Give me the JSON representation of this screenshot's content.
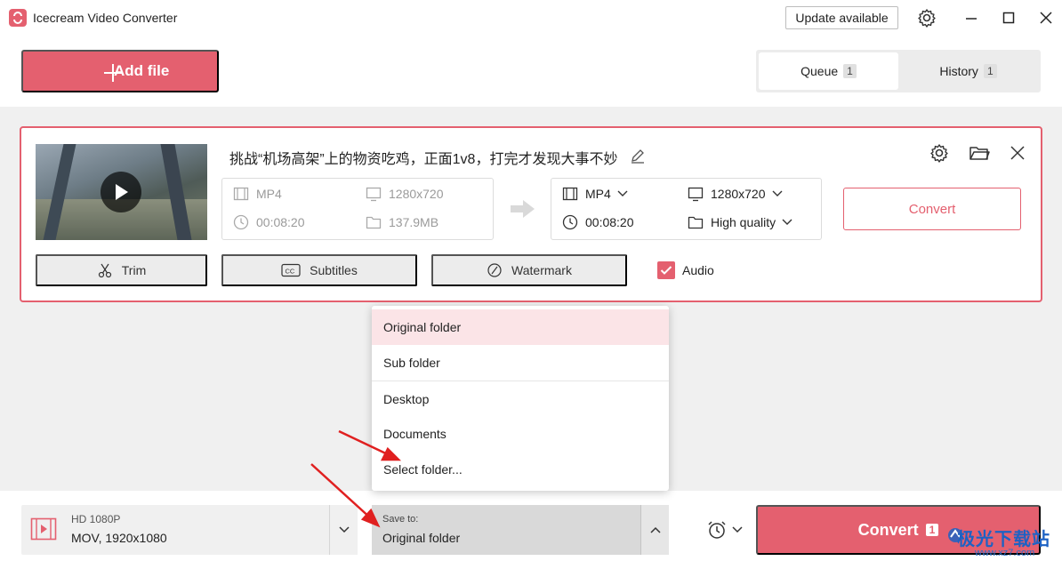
{
  "window": {
    "title": "Icecream Video Converter",
    "update_label": "Update available"
  },
  "toolbar": {
    "add_file_label": "Add file"
  },
  "tabs": [
    {
      "label": "Queue",
      "count": "1",
      "active": true
    },
    {
      "label": "History",
      "count": "1",
      "active": false
    }
  ],
  "file": {
    "title": "挑战“机场高架”上的物资吃鸡，正面1v8，打完才发现大事不妙",
    "source": {
      "format": "MP4",
      "resolution": "1280x720",
      "duration": "00:08:20",
      "size": "137.9MB"
    },
    "target": {
      "format": "MP4",
      "resolution": "1280x720",
      "duration": "00:08:20",
      "quality": "High quality"
    },
    "convert_label": "Convert",
    "tools": {
      "trim": "Trim",
      "subtitles": "Subtitles",
      "watermark": "Watermark",
      "audio": "Audio"
    }
  },
  "save_dropdown": {
    "options": [
      "Original folder",
      "Sub folder",
      "Desktop",
      "Documents",
      "Select folder..."
    ],
    "selected": "Original folder"
  },
  "bottom": {
    "format_small": "HD 1080P",
    "format_main": "MOV, 1920x1080",
    "save_label": "Save to:",
    "save_value": "Original folder",
    "convert_label": "Convert",
    "convert_count": "1"
  },
  "watermark": {
    "text": "极光下载站",
    "url": "www.xz7.com"
  },
  "colors": {
    "accent": "#e4606f",
    "annotation": "#e02020"
  }
}
